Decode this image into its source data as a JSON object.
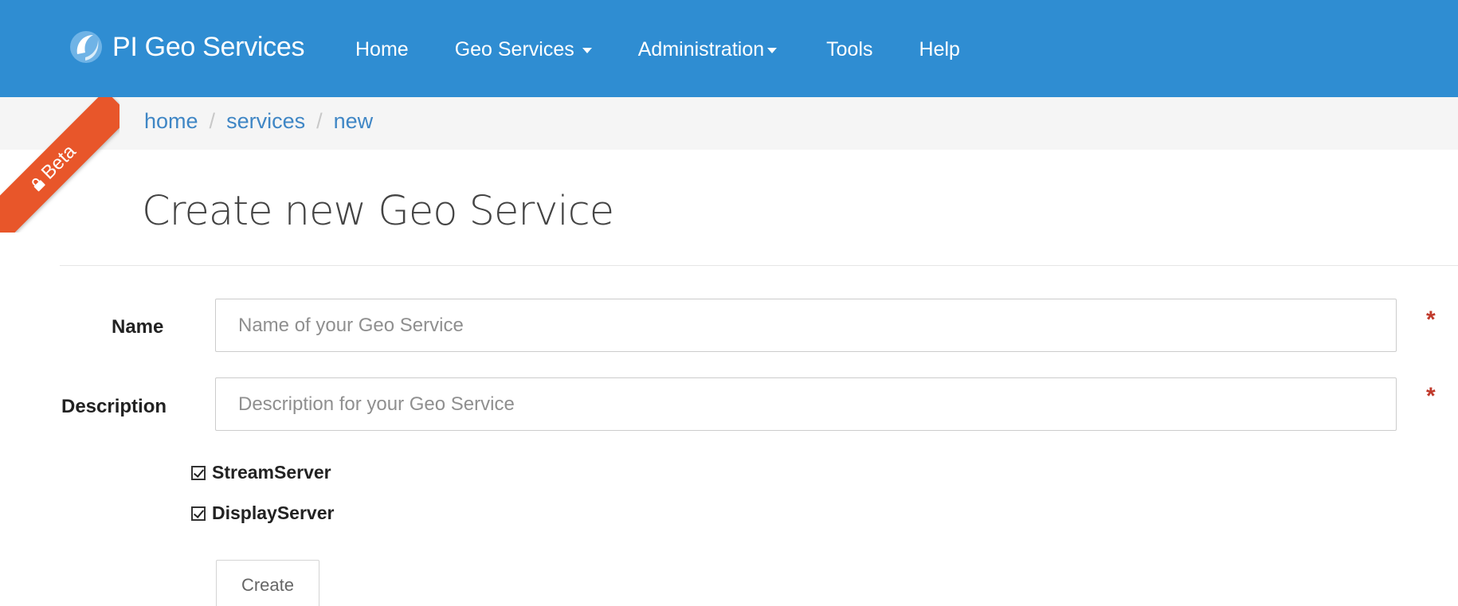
{
  "navbar": {
    "brand": "PI Geo Services",
    "items": [
      {
        "label": "Home"
      },
      {
        "label": "Geo Services"
      },
      {
        "label": "Administration"
      },
      {
        "label": "Tools"
      },
      {
        "label": "Help"
      }
    ]
  },
  "ribbon": {
    "label": "Beta"
  },
  "breadcrumb": {
    "items": [
      "home",
      "services",
      "new"
    ],
    "separator": "/"
  },
  "page": {
    "title": "Create new Geo Service"
  },
  "form": {
    "name_label": "Name",
    "name_placeholder": "Name of your Geo Service",
    "name_value": "",
    "description_label": "Description",
    "description_placeholder": "Description for your Geo Service",
    "description_value": "",
    "required_marker": "*",
    "checkboxes": [
      {
        "label": "StreamServer",
        "checked": true
      },
      {
        "label": "DisplayServer",
        "checked": true
      }
    ],
    "submit_label": "Create"
  },
  "colors": {
    "navbar": "#2f8dd2",
    "ribbon": "#e8562a",
    "link": "#3f86c5",
    "required": "#c0392b"
  },
  "icons": {
    "brand": "pi-logo-icon",
    "ribbon": "lock-icon",
    "dropdown": "caret-down-icon",
    "checkbox": "checkmark-icon"
  }
}
